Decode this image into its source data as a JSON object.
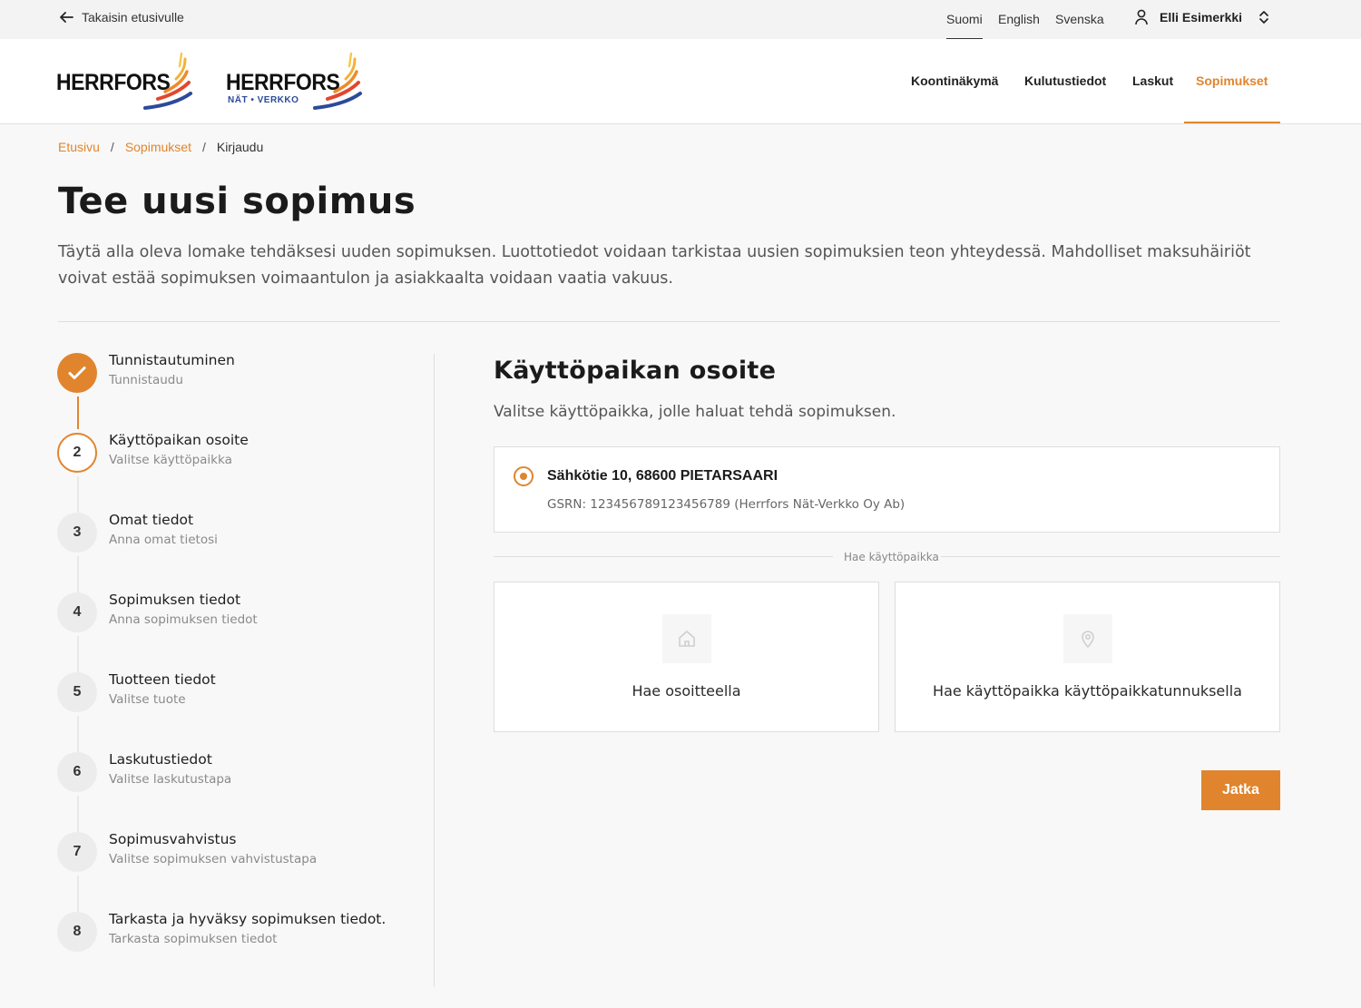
{
  "topbar": {
    "back_label": "Takaisin etusivulle",
    "languages": [
      "Suomi",
      "English",
      "Svenska"
    ],
    "active_language": "Suomi",
    "user_name": "Elli Esimerkki"
  },
  "header": {
    "logos": [
      {
        "text": "HERRFORS",
        "sub": ""
      },
      {
        "text": "HERRFORS",
        "sub": "NÄT • VERKKO"
      }
    ],
    "nav": [
      "Koontinäkymä",
      "Kulutustiedot",
      "Laskut",
      "Sopimukset"
    ],
    "active_nav": "Sopimukset"
  },
  "breadcrumb": {
    "items": [
      "Etusivu",
      "Sopimukset",
      "Kirjaudu"
    ],
    "separator": "/"
  },
  "page": {
    "title": "Tee uusi sopimus",
    "intro": "Täytä alla oleva lomake tehdäksesi uuden sopimuksen. Luottotiedot voidaan tarkistaa uusien sopimuksien teon yhteydessä. Mahdolliset maksuhäiriöt voivat estää sopimuksen voimaantulon ja asiakkaalta voidaan vaatia vakuus."
  },
  "steps": [
    {
      "number": "1",
      "title": "Tunnistautuminen",
      "subtitle": "Tunnistaudu",
      "status": "done"
    },
    {
      "number": "2",
      "title": "Käyttöpaikan osoite",
      "subtitle": "Valitse käyttöpaikka",
      "status": "current"
    },
    {
      "number": "3",
      "title": "Omat tiedot",
      "subtitle": "Anna omat tietosi",
      "status": "pending"
    },
    {
      "number": "4",
      "title": "Sopimuksen tiedot",
      "subtitle": "Anna sopimuksen tiedot",
      "status": "pending"
    },
    {
      "number": "5",
      "title": "Tuotteen tiedot",
      "subtitle": "Valitse tuote",
      "status": "pending"
    },
    {
      "number": "6",
      "title": "Laskutustiedot",
      "subtitle": "Valitse laskutustapa",
      "status": "pending"
    },
    {
      "number": "7",
      "title": "Sopimusvahvistus",
      "subtitle": "Valitse sopimuksen vahvistustapa",
      "status": "pending"
    },
    {
      "number": "8",
      "title": "Tarkasta ja hyväksy sopimuksen tiedot.",
      "subtitle": "Tarkasta sopimuksen tiedot",
      "status": "pending"
    }
  ],
  "panel": {
    "title": "Käyttöpaikan osoite",
    "description": "Valitse käyttöpaikka, jolle haluat tehdä sopimuksen.",
    "address": {
      "title": "Sähkötie 10, 68600 PIETARSAARI",
      "subtitle": "GSRN: 123456789123456789 (Herrfors Nät-Verkko Oy Ab)",
      "selected": true
    },
    "search_divider": "Hae käyttöpaikka",
    "search_options": [
      {
        "label": "Hae osoitteella",
        "icon": "home-icon"
      },
      {
        "label": "Hae käyttöpaikka käyttöpaikkatunnuksella",
        "icon": "location-pin-icon"
      }
    ],
    "continue_label": "Jatka"
  },
  "colors": {
    "accent": "#e0852e",
    "background": "#f8f8f8",
    "logo_blue": "#2b4a9a"
  }
}
